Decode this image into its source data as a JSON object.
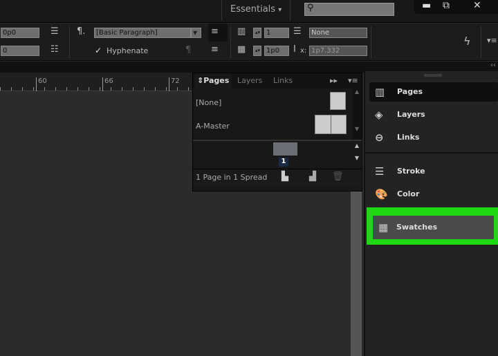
{
  "topbar": {
    "workspace": "Essentials",
    "workspace_arrow": "▾",
    "search_placeholder": "",
    "minimize": "▬",
    "restore": "⧉",
    "close": "✕"
  },
  "control": {
    "indent_left": "0p0",
    "indent_first": "0",
    "paragraph_style": "[Basic Paragraph]",
    "hyphenate_label": "Hyphenate",
    "hyphenate_checked": true,
    "columns": "1",
    "gutter": "1p0",
    "span": "None",
    "x_label": "x:",
    "x_value": "1p7.332"
  },
  "ruler": {
    "ticks": [
      "60",
      "66",
      "72"
    ]
  },
  "pages_panel": {
    "tabs": [
      "Pages",
      "Layers",
      "Links"
    ],
    "active_tab": "Pages",
    "masters": [
      "[None]",
      "A-Master"
    ],
    "page_number": "1",
    "status": "1 Page in 1 Spread"
  },
  "dock": {
    "collapse": "‹‹",
    "items": [
      {
        "label": "Pages",
        "icon": "pages-icon"
      },
      {
        "label": "Layers",
        "icon": "layers-icon"
      },
      {
        "label": "Links",
        "icon": "links-icon"
      },
      {
        "label": "Stroke",
        "icon": "stroke-icon"
      },
      {
        "label": "Color",
        "icon": "color-icon"
      },
      {
        "label": "Swatches",
        "icon": "swatches-icon"
      }
    ],
    "highlight_color": "#1ed90f"
  }
}
